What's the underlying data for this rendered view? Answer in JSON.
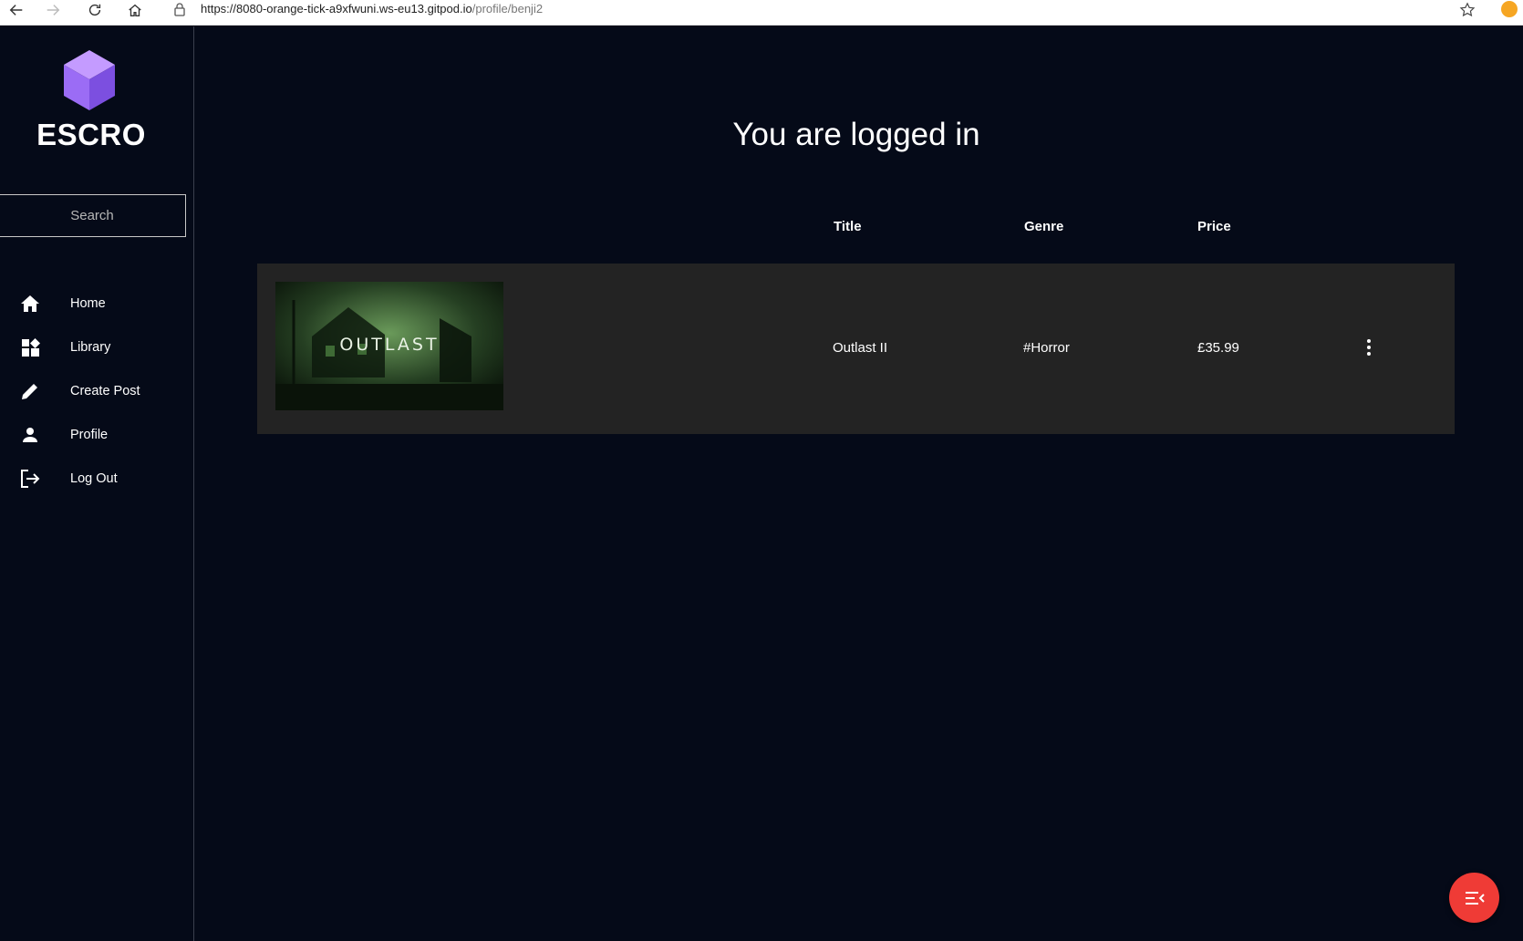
{
  "browser": {
    "url_main": "https://8080-orange-tick-a9xfwuni.ws-eu13.gitpod.io",
    "url_path": "/profile/benji2"
  },
  "sidebar": {
    "brand": "ESCRO",
    "search_placeholder": "Search",
    "items": [
      {
        "label": "Home",
        "icon": "home-icon"
      },
      {
        "label": "Library",
        "icon": "library-icon"
      },
      {
        "label": "Create Post",
        "icon": "pencil-icon"
      },
      {
        "label": "Profile",
        "icon": "person-icon"
      },
      {
        "label": "Log Out",
        "icon": "logout-icon"
      }
    ]
  },
  "main": {
    "title": "You are logged in",
    "columns": {
      "title": "Title",
      "genre": "Genre",
      "price": "Price"
    },
    "rows": [
      {
        "thumbnail_text": "OUTLAST",
        "title": "Outlast II",
        "genre": "#Horror",
        "price": "£35.99"
      }
    ]
  },
  "colors": {
    "background": "#050a18",
    "row": "#232323",
    "fab": "#ef3b36",
    "logo": "#9b6cf5"
  }
}
